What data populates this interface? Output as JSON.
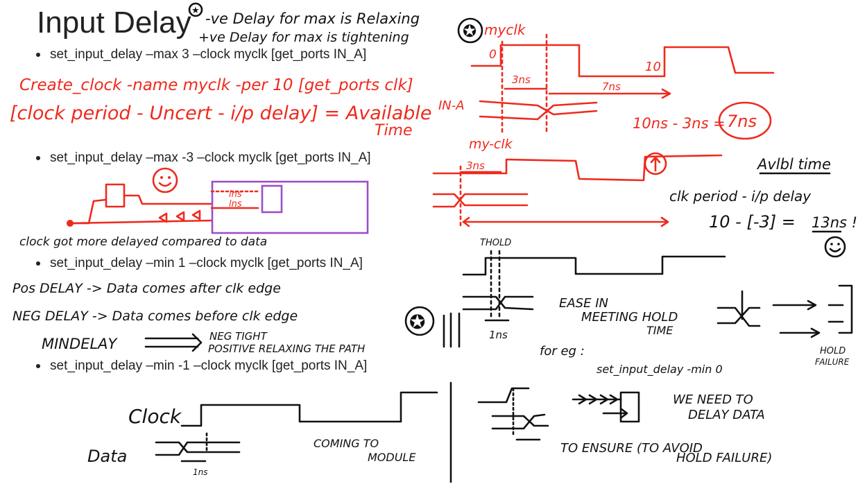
{
  "slide": {
    "title": "Input Delay",
    "bullets": [
      "set_input_delay –max 3 –clock myclk [get_ports IN_A]",
      "set_input_delay –max -3 –clock myclk [get_ports IN_A]",
      "set_input_delay –min 1 –clock myclk [get_ports IN_A]",
      "set_input_delay –min -1 –clock myclk [get_ports IN_A]"
    ]
  },
  "annotations": {
    "top_note_1": "-ve Delay for max is Relaxing",
    "top_note_2": "+ve Delay for max is tightening",
    "create_clock": "Create_clock -name myclk -per 10 [get_ports clk]",
    "formula": "[clock period - Uncert - i/p delay] = Available",
    "formula_time": "Time",
    "myclk_label": "myclk",
    "zero": "0",
    "ten": "10",
    "three_ns": "3ns",
    "seven_ns": "7ns",
    "in_a": "IN-A",
    "calc_1": "10ns - 3ns =",
    "calc_1_result": "7ns",
    "my_clk_label": "my-clk",
    "three_ns_2": "3ns",
    "avlbl_time": "Avlbl time",
    "clk_period_label": "clk period - i/p delay",
    "calc_2": "10 - [-3] =",
    "calc_2_result": "13ns !!",
    "ins_1": "ins",
    "ins_2": "lns",
    "clock_delayed": "clock got more delayed compared to data",
    "thold": "THOLD",
    "pos_delay": "Pos DELAY -> Data comes after clk edge",
    "neg_delay": "NEG DELAY -> Data comes before clk edge",
    "mindelay": "MINDELAY",
    "neg_tight": "NEG TIGHT",
    "positive_relax": "POSITIVE RELAXING THE PATH",
    "ease_1": "EASE IN",
    "ease_2": "MEETING HOLD",
    "ease_3": "TIME",
    "one_ns": "1ns",
    "hold_1": "HOLD",
    "hold_2": "FAILURE",
    "for_eg": "for eg :",
    "set_input_min0": "set_input_delay -min 0",
    "clock_word": "Clock",
    "data_word": "Data",
    "one_ns_bottom": "1ns",
    "coming_1": "COMING TO",
    "coming_2": "MODULE",
    "we_need_1": "WE NEED TO",
    "we_need_2": "DELAY DATA",
    "to_ensure_1": "TO ENSURE (TO AVOID",
    "to_ensure_2": "HOLD FAILURE)"
  },
  "colors": {
    "ink_red": "#ee2a1d",
    "ink_black": "#111111",
    "ink_purple": "#9b4fc8",
    "text": "#222222"
  }
}
